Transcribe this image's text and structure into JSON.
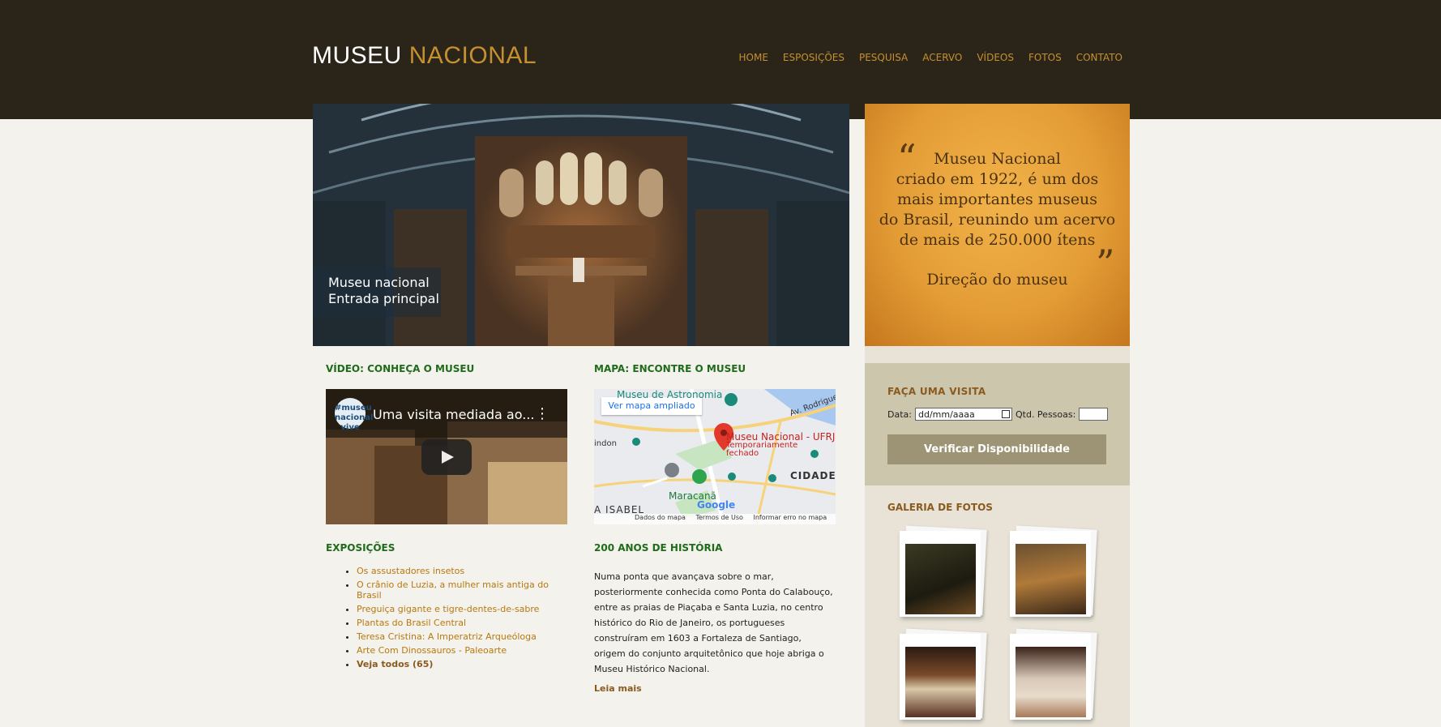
{
  "header": {
    "logo_part1": "MUSEU",
    "logo_part2": "NACIONAL",
    "nav": [
      "HOME",
      "ESPOSIÇÕES",
      "PESQUISA",
      "ACERVO",
      "VÍDEOS",
      "FOTOS",
      "CONTATO"
    ]
  },
  "hero": {
    "caption_line1": "Museu nacional",
    "caption_line2": "Entrada principal"
  },
  "quote": {
    "open_mark": "“",
    "close_mark": "”",
    "lines": [
      "Museu Nacional",
      "criado em 1922, é um dos",
      "mais importantes museus",
      "do Brasil, reunindo um acervo",
      "de mais de 250.000 ítens"
    ],
    "author": "Direção do museu"
  },
  "video": {
    "section_title": "VÍDEO: CONHEÇA O MUSEU",
    "title": "Uma visita mediada ao...",
    "channel": "#museu nacional vive"
  },
  "map": {
    "section_title": "MAPA: ENCONTRE O MUSEU",
    "expand_link": "Ver mapa ampliado",
    "place_name": "Museu Nacional - UFRJ",
    "place_status": "Temporariamente fechado",
    "labels": [
      "Museu de Astronomia",
      "Av. Rodrigues",
      "CIDADE",
      "Maracanã",
      "A ISABEL",
      "Google",
      "indon"
    ],
    "footer": [
      "Dados do mapa",
      "Termos de Uso",
      "Informar erro no mapa"
    ]
  },
  "exposicoes": {
    "title": "EXPOSIÇÕES",
    "items": [
      "Os assustadores insetos",
      "O crânio de Luzia, a mulher mais antiga do Brasil",
      "Preguiça gigante e tigre-dentes-de-sabre",
      "Plantas do Brasil Central",
      "Teresa Cristina: A Imperatriz Arqueóloga",
      "Arte Com Dinossauros - Paleoarte"
    ],
    "all_link": "Veja todos (65)"
  },
  "historia": {
    "title": "200 ANOS DE HISTÓRIA",
    "text": "Numa ponta que avançava sobre o mar, posteriormente conhecida como Ponta do Calabouço, entre as praias de Piaçaba e Santa Luzia, no centro histórico do Rio de Janeiro, os portugueses construíram em 1603 a Fortaleza de Santiago, origem do conjunto arquitetônico que hoje abriga o Museu Histórico Nacional.",
    "more": "Leia mais"
  },
  "visita": {
    "title": "FAÇA UMA VISITA",
    "date_label": "Data:",
    "date_placeholder": "dd/mm/aaaa",
    "qty_label": "Qtd. Pessoas:",
    "button": "Verificar Disponibilidade"
  },
  "galeria": {
    "title": "GALERIA DE FOTOS"
  },
  "colors": {
    "header_bg": "#2a2419",
    "accent": "#c6902f",
    "section_green": "#1e6b1a"
  }
}
